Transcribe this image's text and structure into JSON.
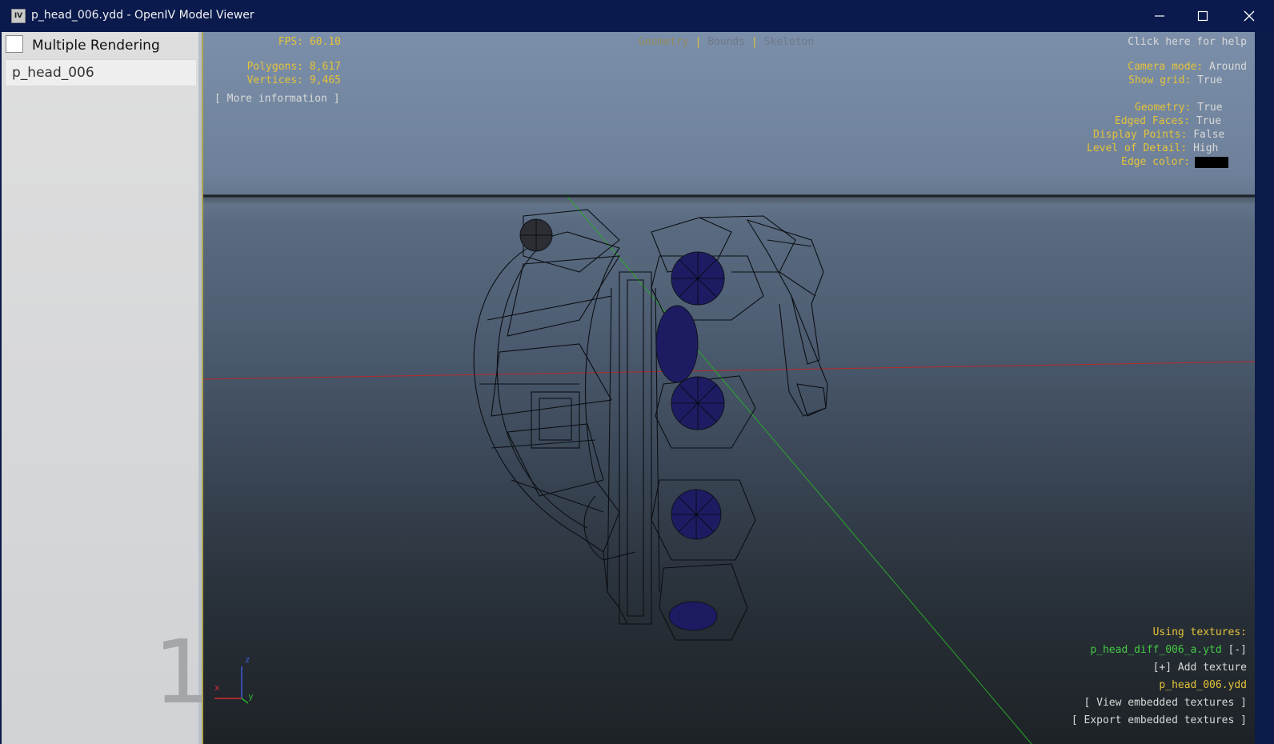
{
  "window": {
    "title": "p_head_006.ydd - OpenIV Model Viewer",
    "icon": "IV",
    "minimize_icon": "minimize-icon",
    "maximize_icon": "maximize-icon",
    "close_icon": "close-icon"
  },
  "sidebar": {
    "multiple_rendering_label": "Multiple Rendering",
    "multiple_rendering_checked": false,
    "models": [
      "p_head_006"
    ],
    "lod_number": "1"
  },
  "hud": {
    "fps_label": "FPS:",
    "fps_value": "60.10",
    "polygons_label": "Polygons:",
    "polygons_value": "8,617",
    "vertices_label": "Vertices:",
    "vertices_value": "9,465",
    "more_info": "[ More information ]",
    "tabs": {
      "geometry": "Geometry",
      "sep": "|",
      "bounds": "Bounds",
      "skeleton": "Skeleton"
    },
    "help": "Click here for help",
    "camera_mode_label": "Camera mode:",
    "camera_mode_value": "Around",
    "show_grid_label": "Show grid:",
    "show_grid_value": "True",
    "geometry_label": "Geometry:",
    "geometry_value": "True",
    "edged_faces_label": "Edged Faces:",
    "edged_faces_value": "True",
    "display_points_label": "Display Points:",
    "display_points_value": "False",
    "lod_label": "Level of Detail:",
    "lod_value": "High",
    "edge_color_label": "Edge color:",
    "edge_color_value": "#000000",
    "using_textures": "Using textures:",
    "texture_file": "p_head_diff_006_a.ytd",
    "remove_texture": "[-]",
    "add_texture": "[+] Add texture",
    "ydd_file": "p_head_006.ydd",
    "view_embedded": "[ View embedded textures ]",
    "export_embedded": "[ Export embedded textures ]"
  },
  "axis_gizmo": {
    "x": "x",
    "y": "y",
    "z": "z"
  },
  "colors": {
    "hud_yellow": "#e4c23a",
    "hud_green": "#44c944",
    "titlebar": "#0a1a4d"
  }
}
